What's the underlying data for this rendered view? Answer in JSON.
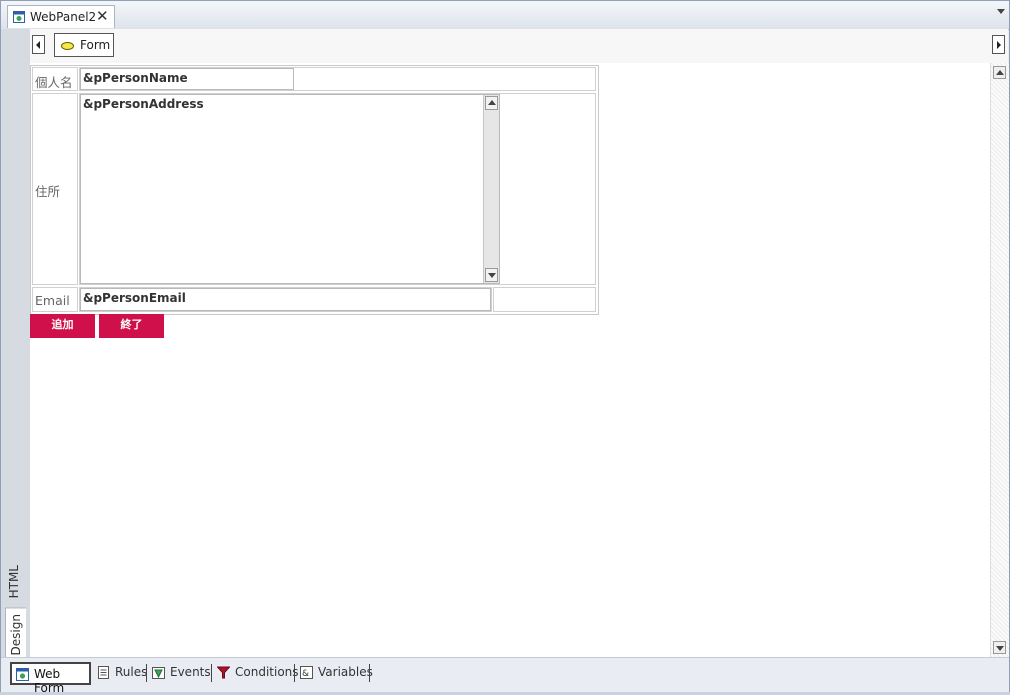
{
  "tab": {
    "title": "WebPanel2",
    "close": "✕"
  },
  "breadcrumb": {
    "item": "Form"
  },
  "side_tabs": {
    "html": "HTML",
    "design": "Design"
  },
  "form": {
    "name_label": "個人名",
    "name_value": "&pPersonName",
    "address_label": "住所",
    "address_value": "&pPersonAddress",
    "email_label": "Email",
    "email_value": "&pPersonEmail",
    "add_button": "追加",
    "exit_button": "終了",
    "button_color": "#d0104a"
  },
  "bottom_tabs": [
    {
      "label": "Web Form",
      "icon": "web-form-icon",
      "active": true
    },
    {
      "label": "Rules",
      "icon": "rules-icon"
    },
    {
      "label": "Events",
      "icon": "events-icon"
    },
    {
      "label": "Conditions",
      "icon": "conditions-filter-icon"
    },
    {
      "label": "Variables",
      "icon": "variables-icon"
    }
  ]
}
